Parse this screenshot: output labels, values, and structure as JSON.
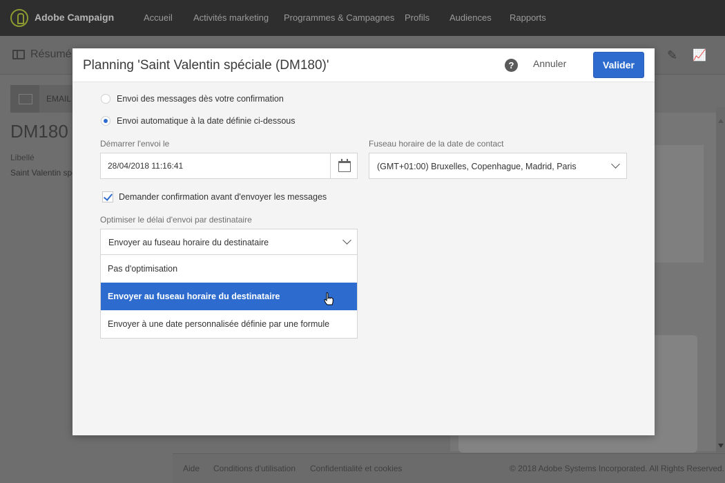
{
  "topbar": {
    "brand": "Adobe Campaign",
    "nav": [
      "Accueil",
      "Activités marketing",
      "Programmes & Campagnes",
      "Profils",
      "Audiences",
      "Rapports"
    ]
  },
  "background": {
    "subtitle": "Résumé",
    "channel": "EMAIL",
    "code": "DM180",
    "libelle_label": "Libellé",
    "libelle_value": "Saint Valentin spe"
  },
  "footer": {
    "links": [
      "Aide",
      "Conditions d'utilisation",
      "Confidentialité et cookies"
    ],
    "copyright": "© 2018 Adobe Systems Incorporated. All Rights Reserved."
  },
  "modal": {
    "title": "Planning 'Saint Valentin spéciale (DM180)'",
    "help": "?",
    "cancel_label": "Annuler",
    "validate_label": "Valider",
    "radio_1": "Envoi des messages dès votre confirmation",
    "radio_2": "Envoi automatique à la date définie ci-dessous",
    "start_label": "Démarrer l'envoi le",
    "start_value": "28/04/2018 11:16:41",
    "timezone_label": "Fuseau horaire de la date de contact",
    "timezone_value": "(GMT+01:00) Bruxelles, Copenhague, Madrid, Paris",
    "confirm_label": "Demander confirmation avant d'envoyer les messages",
    "optimize_label": "Optimiser le délai d'envoi par destinataire",
    "optimize_value": "Envoyer au fuseau horaire du destinataire",
    "options": [
      "Pas d'optimisation",
      "Envoyer au fuseau horaire du destinataire",
      "Envoyer à une date personnalisée définie par une formule"
    ]
  },
  "colors": {
    "accent": "#2d6cce",
    "topbar": "#2e2e2e",
    "overlay": "#6e6e6e",
    "modal_bg": "#f4f4f4"
  }
}
